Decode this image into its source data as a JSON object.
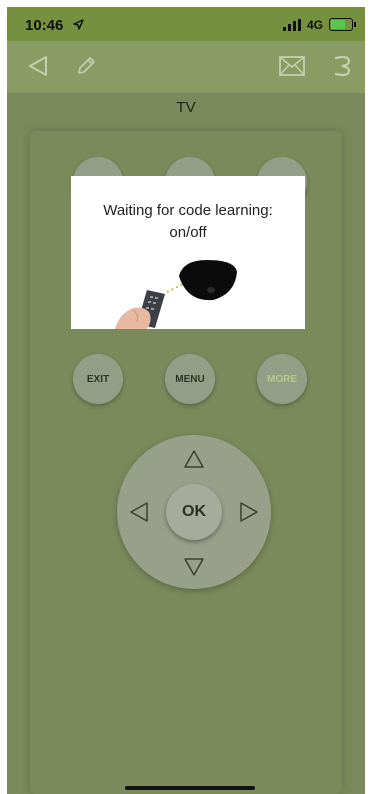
{
  "status_bar": {
    "time": "10:46",
    "network": "4G"
  },
  "nav": {
    "back_icon": "back-triangle-icon",
    "edit_icon": "pencil-icon",
    "mail_icon": "envelope-icon",
    "learn_icon": "learning-icon"
  },
  "device_title": "TV",
  "buttons": {
    "exit": "EXIT",
    "menu": "MENU",
    "more": "MORE",
    "ok": "OK"
  },
  "dialog": {
    "line1": "Waiting for code learning:",
    "line2": "on/off"
  },
  "colors": {
    "status_bar": "#75913f",
    "background": "#7b8a5d",
    "more_label": "#b6c98b"
  }
}
